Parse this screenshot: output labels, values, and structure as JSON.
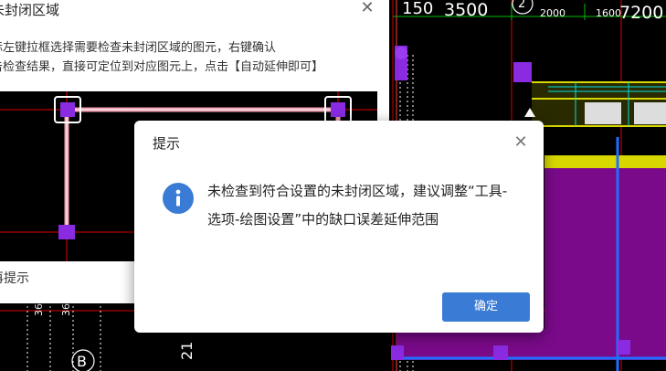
{
  "cad": {
    "labels": {
      "dim_150": "150",
      "dim_3500": "3500",
      "grid_2": "2",
      "dim_2000": "2000",
      "dim_1600": "1600",
      "dim_7200": "7200",
      "grid_b": "B",
      "dim_21": "21",
      "dim_36_a": "36",
      "dim_36_b": "36"
    }
  },
  "back_dialog": {
    "title": "未封闭区域",
    "description_line1": "标左键拉框选择需要检查未封闭区域的图元，右键确认",
    "description_line2": "击检查结果，直接可定位到对应图元上，点击【自动延伸即可】",
    "no_show_label": "再提示",
    "close_glyph": "✕"
  },
  "modal": {
    "title": "提示",
    "close_glyph": "✕",
    "message": "未检查到符合设置的未封闭区域，建议调整“工具-选项-绘图设置”中的缺口误差延伸范围",
    "ok_label": "确定",
    "icon": "info-icon"
  },
  "colors": {
    "accent": "#3a7bd5",
    "wall_magenta": "#7a0a8a",
    "wall_yellow": "#d8d800",
    "grid_red": "#e00000",
    "node_purple": "#8a2be2"
  }
}
